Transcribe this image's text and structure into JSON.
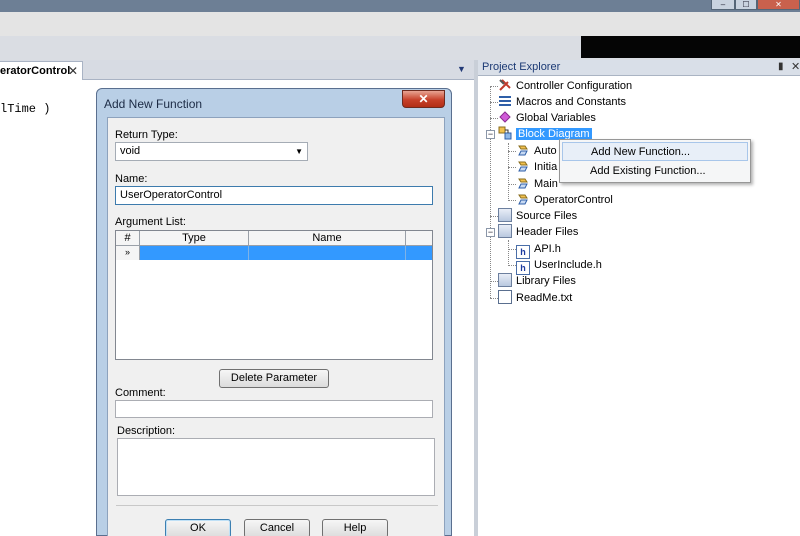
{
  "editor": {
    "tab_label": "eratorControl",
    "tab_close": "✕",
    "tab_dropdown": "▼",
    "code_fragment": "lTime )"
  },
  "window_controls": {
    "minimize": "‒",
    "maximize": "☐",
    "close": "✕"
  },
  "project_explorer": {
    "title": "Project Explorer",
    "pin": "📌",
    "close": "✕",
    "items": [
      {
        "label": "Controller Configuration",
        "icon": "wrench-icon"
      },
      {
        "label": "Macros and Constants",
        "icon": "list-icon"
      },
      {
        "label": "Global Variables",
        "icon": "variable-icon"
      },
      {
        "label": "Block Diagram",
        "icon": "block-diagram-icon"
      },
      {
        "label": "Auto",
        "icon": "function-icon"
      },
      {
        "label": "Initia",
        "icon": "function-icon"
      },
      {
        "label": "Main",
        "icon": "function-icon"
      },
      {
        "label": "OperatorControl",
        "icon": "function-icon"
      },
      {
        "label": "Source Files",
        "icon": "folder-icon"
      },
      {
        "label": "Header Files",
        "icon": "folder-icon"
      },
      {
        "label": "API.h",
        "icon": "header-file-icon"
      },
      {
        "label": "UserInclude.h",
        "icon": "header-file-icon"
      },
      {
        "label": "Library Files",
        "icon": "folder-icon"
      },
      {
        "label": "ReadMe.txt",
        "icon": "text-file-icon"
      }
    ],
    "expander_minus": "−"
  },
  "context_menu": {
    "items": [
      {
        "label": "Add New Function..."
      },
      {
        "label": "Add Existing Function..."
      }
    ]
  },
  "dialog": {
    "title": "Add New Function",
    "close": "✕",
    "return_type_label": "Return Type:",
    "return_type_value": "void",
    "combo_arrow": "▼",
    "name_label": "Name:",
    "name_value": "UserOperatorControl",
    "argument_list_label": "Argument List:",
    "columns": [
      "#",
      "Type",
      "Name"
    ],
    "new_row_marker": "»",
    "delete_parameter": "Delete Parameter",
    "comment_label": "Comment:",
    "description_label": "Description:",
    "ok": "OK",
    "cancel": "Cancel",
    "help": "Help"
  },
  "colors": {
    "selection": "#3399ff",
    "dialog_frame": "#b9cfe6",
    "close_red": "#c7412a"
  }
}
